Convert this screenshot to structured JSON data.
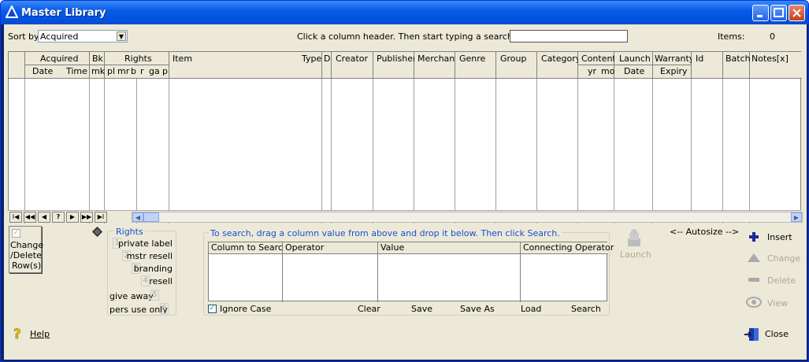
{
  "window": {
    "title": "Master Library"
  },
  "toolbar": {
    "sort_label": "Sort by:",
    "sort_value": "Acquired",
    "search_hint": "Click a column header.  Then start typing a search string",
    "search_value": "",
    "items_label": "Items:",
    "items_count": "0"
  },
  "grid": {
    "groups": {
      "acquired": "Acquired",
      "bk": "Bk",
      "rights": "Rights",
      "content": "Content",
      "launch": "Launch",
      "warranty": "Warranty"
    },
    "sub": {
      "date": "Date",
      "time": "Time",
      "mk": "mk",
      "pl": "pl",
      "mr": "mr",
      "b": "b",
      "r": "r",
      "ga": "ga",
      "p": "p",
      "yr": "yr",
      "mo": "mo",
      "launch_date": "Date",
      "expiry": "Expiry"
    },
    "cols": {
      "item": "Item",
      "type": "Type",
      "d": "D",
      "creator": "Creator",
      "publisher": "Publisher",
      "merchant": "Merchant",
      "genre": "Genre",
      "group": "Group",
      "category": "Category",
      "id": "Id",
      "batch": "Batch",
      "notes": "Notes[x]"
    },
    "nav": {
      "first": "I◀",
      "prev_page": "◀◀",
      "prev": "◀",
      "help": "?",
      "next": "▶",
      "next_page": "▶▶",
      "last": "▶I"
    }
  },
  "left": {
    "change_delete": [
      "Change",
      "/Delete",
      "Row(s)"
    ]
  },
  "rights": {
    "title": "Rights",
    "items": [
      {
        "num": "1",
        "label": "private label"
      },
      {
        "num": "2",
        "label": "mstr resell"
      },
      {
        "num": "3",
        "label": "branding"
      },
      {
        "num": "4",
        "label": "resell"
      },
      {
        "num": "5",
        "label": "give away"
      },
      {
        "num": "6",
        "label": "pers use only"
      }
    ]
  },
  "search": {
    "instruction": "To search, drag a column value from above and drop it below.  Then click Search.",
    "headers": [
      "Column to Search",
      "Operator",
      "Value",
      "Connecting Operator"
    ],
    "ignore_case": "Ignore Case",
    "clear": "Clear",
    "save": "Save",
    "save_as": "Save As",
    "load": "Load",
    "search": "Search"
  },
  "launch": {
    "label": "Launch",
    "autosize": "<-- Autosize -->"
  },
  "actions": {
    "insert": "Insert",
    "change": "Change",
    "delete": "Delete",
    "view": "View",
    "close": "Close"
  },
  "help": "Help"
}
